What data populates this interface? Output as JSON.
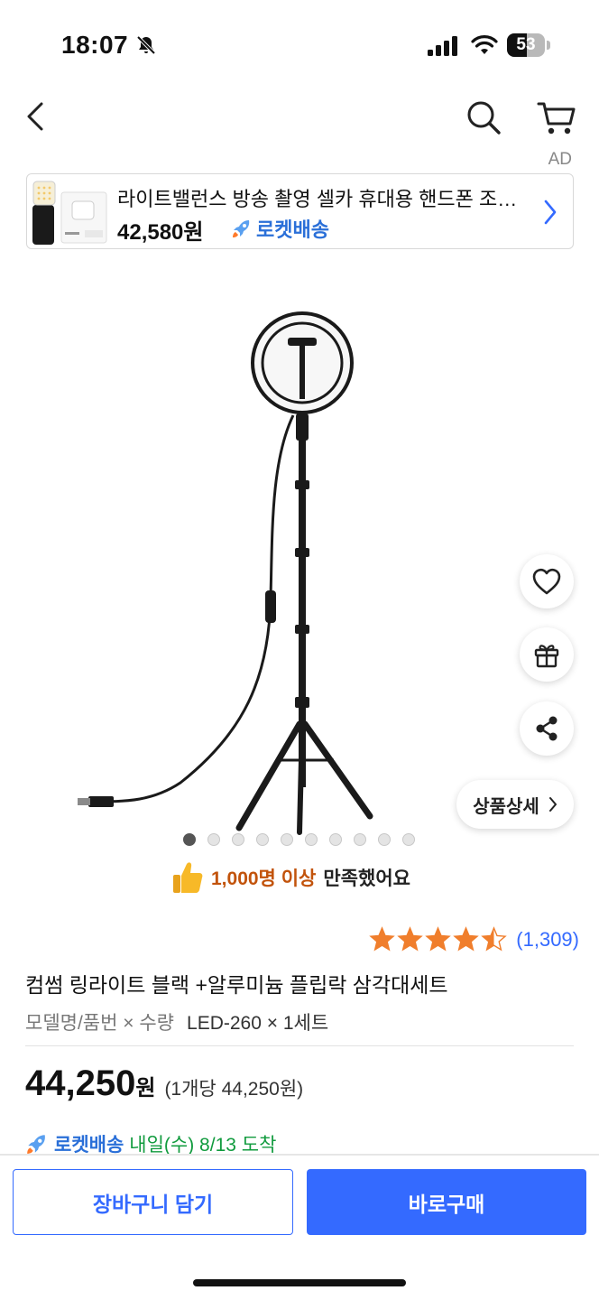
{
  "status_bar": {
    "time": "18:07",
    "battery": "53",
    "battery_level": 0.53,
    "icons": [
      "bell-slash-icon",
      "signal-icon",
      "wifi-icon",
      "battery-icon"
    ]
  },
  "header": {
    "icons": [
      "back-icon",
      "search-icon",
      "cart-icon"
    ]
  },
  "ad": {
    "label": "AD",
    "title": "라이트밸런스 방송 촬영 셀카 휴대용 핸드폰 조명 라이트",
    "price": "42,580원",
    "rocket_label": "로켓배송"
  },
  "gallery": {
    "page_count": 10,
    "active_index": 0
  },
  "actions": {
    "detail_label": "상품상세",
    "icons": [
      "heart-icon",
      "gift-icon",
      "share-icon"
    ]
  },
  "satisfaction": {
    "count": "1,000명 이상",
    "text": "만족했어요"
  },
  "rating": {
    "stars": 4.5,
    "review_count": "(1,309)"
  },
  "product": {
    "title": "컴썸 링라이트 블랙 +알루미늄 플립락 삼각대세트",
    "option_label": "모델명/품번 × 수량",
    "option_value": "LED-260 × 1세트",
    "price": "44,250",
    "price_won": "원",
    "unit_price": "(1개당 44,250원)"
  },
  "delivery": {
    "brand": "로켓배송",
    "date": "내일(수) 8/13 도착"
  },
  "buttons": {
    "cart": "장바구니 담기",
    "buy": "바로구매"
  },
  "colors": {
    "primary": "#346aff",
    "star": "#f07e2c",
    "delivery_green": "#119b3e",
    "satisfaction_orange": "#c2530b"
  }
}
